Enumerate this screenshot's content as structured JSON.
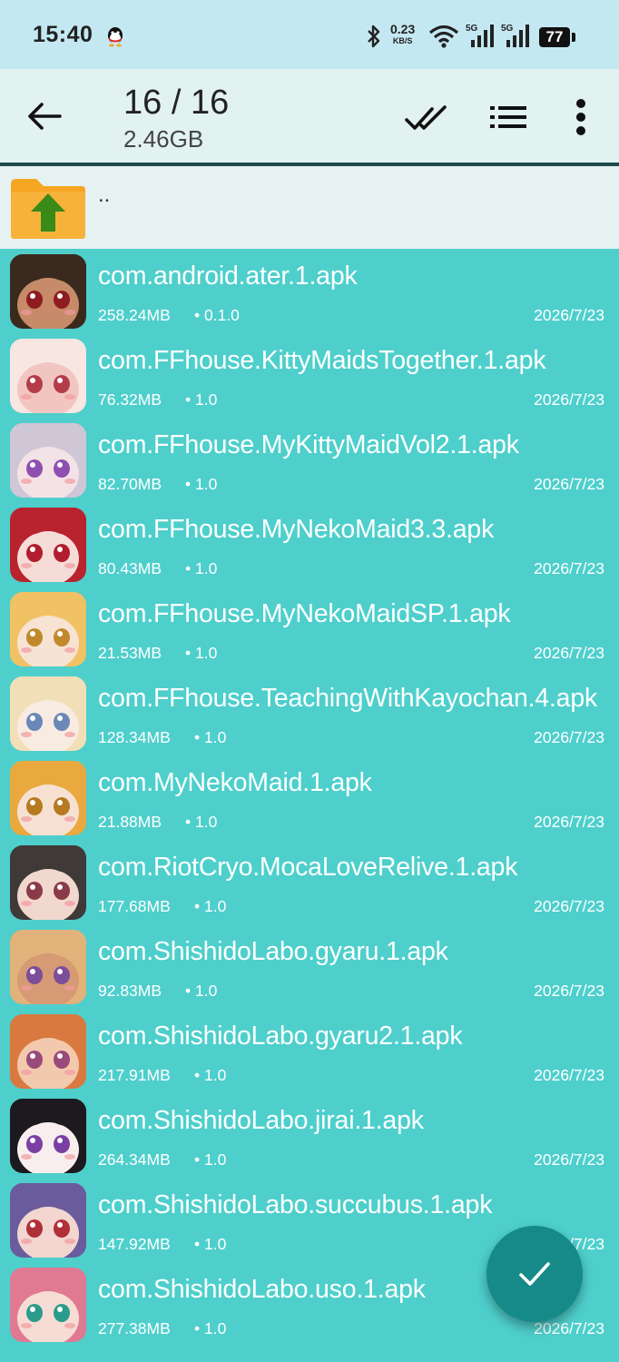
{
  "status_bar": {
    "time": "15:40",
    "net_speed_value": "0.23",
    "net_speed_unit": "KB/S",
    "battery": "77",
    "icons": [
      "qq-icon",
      "bluetooth-icon",
      "wifi-icon",
      "signal-5g-icon",
      "signal-5g-icon"
    ]
  },
  "toolbar": {
    "title": "16 / 16",
    "subtitle": "2.46GB",
    "actions": [
      "back-icon",
      "check-all-icon",
      "list-view-icon",
      "more-icon"
    ]
  },
  "parent_folder": {
    "label": ".."
  },
  "files": [
    {
      "name": "com.android.ater.1.apk",
      "size": "258.24MB",
      "version": "• 0.1.0",
      "date": "2026/7/23",
      "thumb_colors": [
        "#3a2a1e",
        "#c78b6a",
        "#8e1c20"
      ]
    },
    {
      "name": "com.FFhouse.KittyMaidsTogether.1.apk",
      "size": "76.32MB",
      "version": "• 1.0",
      "date": "2026/7/23",
      "thumb_colors": [
        "#f8e6e2",
        "#f2c6c0",
        "#b33c4a"
      ]
    },
    {
      "name": "com.FFhouse.MyKittyMaidVol2.1.apk",
      "size": "82.70MB",
      "version": "• 1.0",
      "date": "2026/7/23",
      "thumb_colors": [
        "#cfc7d6",
        "#f3e3e6",
        "#8f4fb0"
      ]
    },
    {
      "name": "com.FFhouse.MyNekoMaid3.3.apk",
      "size": "80.43MB",
      "version": "• 1.0",
      "date": "2026/7/23",
      "thumb_colors": [
        "#b8232e",
        "#f5dcd7",
        "#b21e2e"
      ]
    },
    {
      "name": "com.FFhouse.MyNekoMaidSP.1.apk",
      "size": "21.53MB",
      "version": "• 1.0",
      "date": "2026/7/23",
      "thumb_colors": [
        "#f0c264",
        "#f7e3d4",
        "#c08a2c"
      ]
    },
    {
      "name": "com.FFhouse.TeachingWithKayochan.4.apk",
      "size": "128.34MB",
      "version": "• 1.0",
      "date": "2026/7/23",
      "thumb_colors": [
        "#f2dfb8",
        "#f8ebe2",
        "#6c88b8"
      ]
    },
    {
      "name": "com.MyNekoMaid.1.apk",
      "size": "21.88MB",
      "version": "• 1.0",
      "date": "2026/7/23",
      "thumb_colors": [
        "#e9a93f",
        "#f7e1d2",
        "#b67a21"
      ]
    },
    {
      "name": "com.RiotCryo.MocaLoveRelive.1.apk",
      "size": "177.68MB",
      "version": "• 1.0",
      "date": "2026/7/23",
      "thumb_colors": [
        "#3f3a37",
        "#f1d8cf",
        "#8a3b47"
      ]
    },
    {
      "name": "com.ShishidoLabo.gyaru.1.apk",
      "size": "92.83MB",
      "version": "• 1.0",
      "date": "2026/7/23",
      "thumb_colors": [
        "#e1b27a",
        "#d69a74",
        "#7b4d9a"
      ]
    },
    {
      "name": "com.ShishidoLabo.gyaru2.1.apk",
      "size": "217.91MB",
      "version": "• 1.0",
      "date": "2026/7/23",
      "thumb_colors": [
        "#d9793f",
        "#f2c9ad",
        "#9a4a7a"
      ]
    },
    {
      "name": "com.ShishidoLabo.jirai.1.apk",
      "size": "264.34MB",
      "version": "• 1.0",
      "date": "2026/7/23",
      "thumb_colors": [
        "#1c1a1e",
        "#f8eeee",
        "#7b3fa4"
      ]
    },
    {
      "name": "com.ShishidoLabo.succubus.1.apk",
      "size": "147.92MB",
      "version": "• 1.0",
      "date": "2026/7/23",
      "thumb_colors": [
        "#6a5c9c",
        "#f2d6cf",
        "#b0303a"
      ]
    },
    {
      "name": "com.ShishidoLabo.uso.1.apk",
      "size": "277.38MB",
      "version": "• 1.0",
      "date": "2026/7/23",
      "thumb_colors": [
        "#e07a92",
        "#f6dcd5",
        "#2a9b8a"
      ]
    }
  ],
  "fab": {
    "icon": "checkmark-icon",
    "color": "#168a88"
  },
  "colors": {
    "list_background": "#4ecfcc",
    "toolbar_background": "#e1f2f0",
    "status_bar_background": "#c4e8f2",
    "folder_orange": "#f5a623",
    "folder_arrow": "#3a8a1a"
  }
}
